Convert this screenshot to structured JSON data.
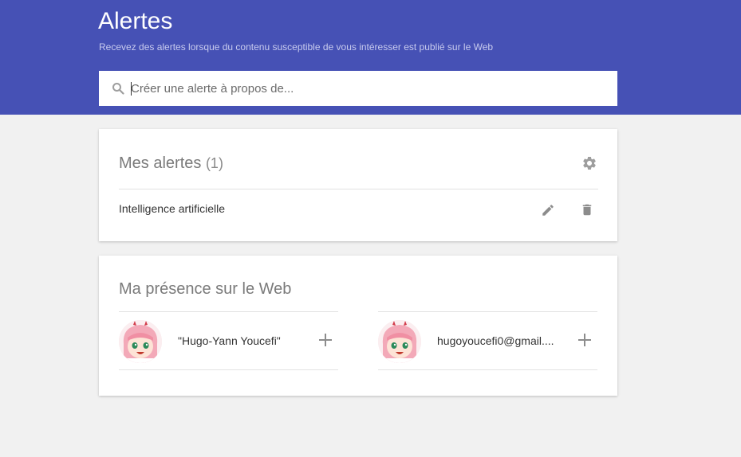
{
  "header": {
    "title": "Alertes",
    "subtitle": "Recevez des alertes lorsque du contenu susceptible de vous intéresser est publié sur le Web",
    "bg_color": "#4651b5"
  },
  "search": {
    "placeholder": "Créer une alerte à propos de...",
    "value": "",
    "icon": "search-icon"
  },
  "my_alerts": {
    "title": "Mes alertes",
    "count": "(1)",
    "settings_icon": "gear-icon",
    "items": [
      {
        "label": "Intelligence artificielle",
        "edit_icon": "pencil-icon",
        "delete_icon": "trash-icon"
      }
    ]
  },
  "web_presence": {
    "title": "Ma présence sur le Web",
    "items": [
      {
        "name": "\"Hugo-Yann Youcefi\"",
        "avatar": "anime-avatar",
        "action_icon": "plus-icon"
      },
      {
        "name": "hugoyoucefi0@gmail....",
        "avatar": "anime-avatar",
        "action_icon": "plus-icon"
      }
    ]
  }
}
